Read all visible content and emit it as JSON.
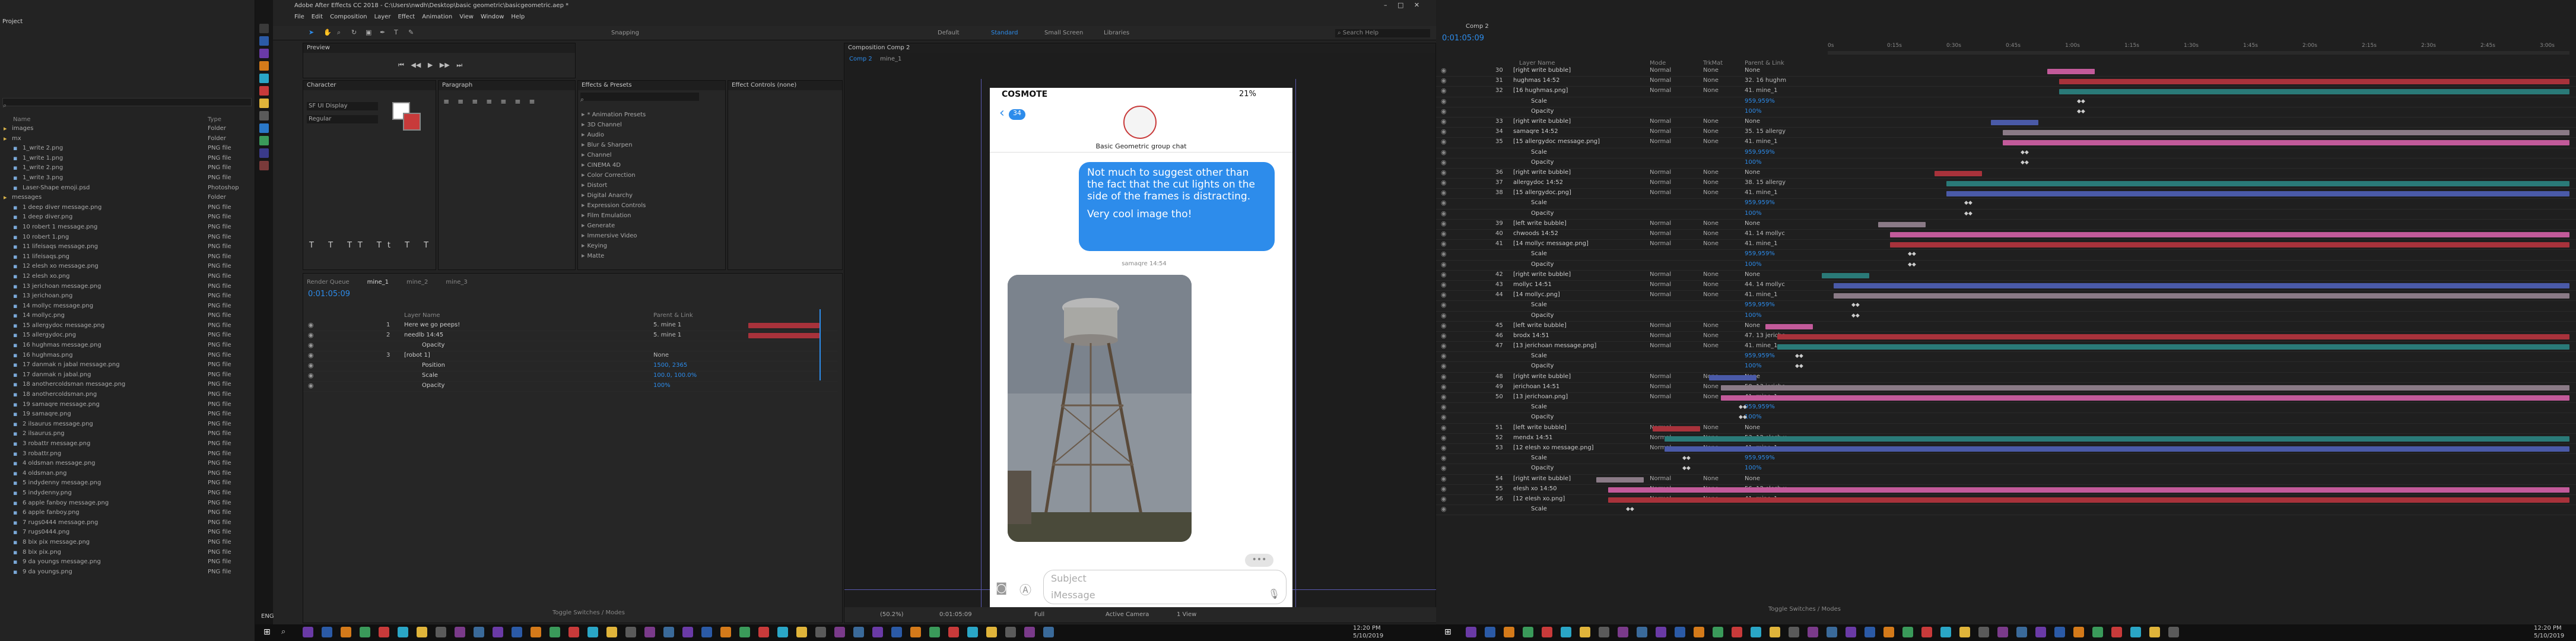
{
  "project": {
    "title": "Project",
    "cols": [
      "Name",
      "Type"
    ],
    "items": [
      {
        "name": "images",
        "type": "Folder"
      },
      {
        "name": "mx",
        "type": "Folder"
      },
      {
        "name": "1_write 2.png",
        "type": "PNG file"
      },
      {
        "name": "1_write 1.png",
        "type": "PNG file"
      },
      {
        "name": "1_write 2.png",
        "type": "PNG file"
      },
      {
        "name": "1_write 3.png",
        "type": "PNG file"
      },
      {
        "name": "Laser-Shape emoji.psd",
        "type": "Photoshop"
      },
      {
        "name": "messages",
        "type": "Folder"
      },
      {
        "name": "1 deep diver message.png",
        "type": "PNG file"
      },
      {
        "name": "1 deep diver.png",
        "type": "PNG file"
      },
      {
        "name": "10 robert 1 message.png",
        "type": "PNG file"
      },
      {
        "name": "10 robert 1.png",
        "type": "PNG file"
      },
      {
        "name": "11 lifeisaqs message.png",
        "type": "PNG file"
      },
      {
        "name": "11 lifeisaqs.png",
        "type": "PNG file"
      },
      {
        "name": "12 elesh xo message.png",
        "type": "PNG file"
      },
      {
        "name": "12 elesh xo.png",
        "type": "PNG file"
      },
      {
        "name": "13 jerichoan message.png",
        "type": "PNG file"
      },
      {
        "name": "13 jerichoan.png",
        "type": "PNG file"
      },
      {
        "name": "14 mollyc message.png",
        "type": "PNG file"
      },
      {
        "name": "14 mollyc.png",
        "type": "PNG file"
      },
      {
        "name": "15 allergydoc message.png",
        "type": "PNG file"
      },
      {
        "name": "15 allergydoc.png",
        "type": "PNG file"
      },
      {
        "name": "16 hughmas message.png",
        "type": "PNG file"
      },
      {
        "name": "16 hughmas.png",
        "type": "PNG file"
      },
      {
        "name": "17 danmak n jabal message.png",
        "type": "PNG file"
      },
      {
        "name": "17 danmak n jabal.png",
        "type": "PNG file"
      },
      {
        "name": "18 anothercoldsman message.png",
        "type": "PNG file"
      },
      {
        "name": "18 anothercoldsman.png",
        "type": "PNG file"
      },
      {
        "name": "19 samaqre message.png",
        "type": "PNG file"
      },
      {
        "name": "19 samaqre.png",
        "type": "PNG file"
      },
      {
        "name": "2 ilsaurus message.png",
        "type": "PNG file"
      },
      {
        "name": "2 ilsaurus.png",
        "type": "PNG file"
      },
      {
        "name": "3 robattr message.png",
        "type": "PNG file"
      },
      {
        "name": "3 robattr.png",
        "type": "PNG file"
      },
      {
        "name": "4 oldsman message.png",
        "type": "PNG file"
      },
      {
        "name": "4 oldsman.png",
        "type": "PNG file"
      },
      {
        "name": "5 indydenny message.png",
        "type": "PNG file"
      },
      {
        "name": "5 indydenny.png",
        "type": "PNG file"
      },
      {
        "name": "6 apple fanboy message.png",
        "type": "PNG file"
      },
      {
        "name": "6 apple fanboy.png",
        "type": "PNG file"
      },
      {
        "name": "7 rugs0444 message.png",
        "type": "PNG file"
      },
      {
        "name": "7 rugs0444.png",
        "type": "PNG file"
      },
      {
        "name": "8 bix pix message.png",
        "type": "PNG file"
      },
      {
        "name": "8 bix pix.png",
        "type": "PNG file"
      },
      {
        "name": "9 da youngs message.png",
        "type": "PNG file"
      },
      {
        "name": "9 da youngs.png",
        "type": "PNG file"
      }
    ]
  },
  "titlebar": {
    "title": "Adobe After Effects CC 2018 - C:\\Users\\nwdh\\Desktop\\basic geometric\\basicgeometric.aep *"
  },
  "menu": [
    "File",
    "Edit",
    "Composition",
    "Layer",
    "Effect",
    "Animation",
    "View",
    "Window",
    "Help"
  ],
  "workspaces": [
    "Default",
    "Standard",
    "Small Screen",
    "Libraries"
  ],
  "search_help": "Search Help",
  "snapping": "Snapping",
  "preview": {
    "title": "Preview"
  },
  "character": {
    "title": "Character",
    "font": "SF UI Display",
    "style": "Regular"
  },
  "paragraph": {
    "title": "Paragraph"
  },
  "effects": {
    "title": "Effects & Presets",
    "list": [
      "* Animation Presets",
      "3D Channel",
      "Audio",
      "Blur & Sharpen",
      "Channel",
      "CINEMA 4D",
      "Color Correction",
      "Distort",
      "Digital Anarchy",
      "Expression Controls",
      "Film Emulation",
      "Generate",
      "Immersive Video",
      "Keying",
      "Matte"
    ]
  },
  "effect_controls": {
    "title": "Effect Controls (none)"
  },
  "comp_panel": {
    "title": "Composition Comp 2",
    "tabs": [
      "Comp 2",
      "mine_1"
    ]
  },
  "phone": {
    "carrier": "COSMOTE",
    "battery": "21%",
    "back_count": "34",
    "group_name": "Basic Geometric group chat",
    "bubble_text": "Not much to suggest other than the fact that the cut lights on the side of the frames is distracting.",
    "bubble_text2": "Very cool image tho!",
    "sender": "samaqre 14:54",
    "subject_placeholder": "Subject",
    "imessage_placeholder": "iMessage"
  },
  "comp_footer": {
    "zoom": "(50.2%)",
    "timecode": "0:01:05:09",
    "quality": "Full",
    "camera": "Active Camera",
    "view": "1 View"
  },
  "left_timeline": {
    "tabs": [
      "Render Queue",
      "mine_1",
      "mine_2",
      "mine_3"
    ],
    "timecode": "0:01:05:09",
    "col_layer": "Layer Name",
    "col_parent": "Parent & Link",
    "layers": [
      {
        "num": "1",
        "name": "Here we go peeps!",
        "parent": "5. mine 1"
      },
      {
        "num": "2",
        "name": "needlb  14:45",
        "parent": "5. mine 1"
      },
      {
        "num": "",
        "name": "Opacity",
        "parent": ""
      },
      {
        "num": "3",
        "name": "[robot 1]",
        "parent": "None"
      },
      {
        "num": "",
        "name": "Position",
        "parent": "1500, 2365"
      },
      {
        "num": "",
        "name": "Scale",
        "parent": "100.0, 100.0%"
      },
      {
        "num": "",
        "name": "Opacity",
        "parent": "100%"
      }
    ],
    "toggle": "Toggle Switches / Modes"
  },
  "right_timeline": {
    "tab": "Comp 2",
    "timecode": "0:01:05:09",
    "col_layer": "Layer Name",
    "col_mode": "Mode",
    "col_trkmat": "TrkMat",
    "col_parent": "Parent & Link",
    "ticks": [
      "0s",
      "0:15s",
      "0:30s",
      "0:45s",
      "1:00s",
      "1:15s",
      "1:30s",
      "1:45s",
      "2:00s",
      "2:15s",
      "2:30s",
      "2:45s",
      "3:00s"
    ],
    "layers": [
      {
        "num": "30",
        "name": "[right write bubble]",
        "mode": "Normal",
        "trk": "None",
        "parent": "None"
      },
      {
        "num": "31",
        "name": "hughmas  14:52",
        "mode": "Normal",
        "trk": "None",
        "parent": "32. 16 hughm"
      },
      {
        "num": "32",
        "name": "[16 hughmas.png]",
        "mode": "Normal",
        "trk": "None",
        "parent": "41. mine_1"
      },
      {
        "num": "",
        "name": "Scale",
        "mode": "",
        "trk": "",
        "parent": "959,959%"
      },
      {
        "num": "",
        "name": "Opacity",
        "mode": "",
        "trk": "",
        "parent": "100%"
      },
      {
        "num": "33",
        "name": "[right write bubble]",
        "mode": "Normal",
        "trk": "None",
        "parent": "None"
      },
      {
        "num": "34",
        "name": "samaqre  14:52",
        "mode": "Normal",
        "trk": "None",
        "parent": "35. 15 allergy"
      },
      {
        "num": "35",
        "name": "[15 allergydoc message.png]",
        "mode": "Normal",
        "trk": "None",
        "parent": "41. mine_1"
      },
      {
        "num": "",
        "name": "Scale",
        "mode": "",
        "trk": "",
        "parent": "959,959%"
      },
      {
        "num": "",
        "name": "Opacity",
        "mode": "",
        "trk": "",
        "parent": "100%"
      },
      {
        "num": "36",
        "name": "[right write bubble]",
        "mode": "Normal",
        "trk": "None",
        "parent": "None"
      },
      {
        "num": "37",
        "name": "allergydoc  14:52",
        "mode": "Normal",
        "trk": "None",
        "parent": "38. 15 allergy"
      },
      {
        "num": "38",
        "name": "[15 allergydoc.png]",
        "mode": "Normal",
        "trk": "None",
        "parent": "41. mine_1"
      },
      {
        "num": "",
        "name": "Scale",
        "mode": "",
        "trk": "",
        "parent": "959,959%"
      },
      {
        "num": "",
        "name": "Opacity",
        "mode": "",
        "trk": "",
        "parent": "100%"
      },
      {
        "num": "39",
        "name": "[left write bubble]",
        "mode": "Normal",
        "trk": "None",
        "parent": "None"
      },
      {
        "num": "40",
        "name": "chwoods  14:52",
        "mode": "Normal",
        "trk": "None",
        "parent": "41. 14 mollyc"
      },
      {
        "num": "41",
        "name": "[14 mollyc message.png]",
        "mode": "Normal",
        "trk": "None",
        "parent": "41. mine_1"
      },
      {
        "num": "",
        "name": "Scale",
        "mode": "",
        "trk": "",
        "parent": "959,959%"
      },
      {
        "num": "",
        "name": "Opacity",
        "mode": "",
        "trk": "",
        "parent": "100%"
      },
      {
        "num": "42",
        "name": "[right write bubble]",
        "mode": "Normal",
        "trk": "None",
        "parent": "None"
      },
      {
        "num": "43",
        "name": "mollyc  14:51",
        "mode": "Normal",
        "trk": "None",
        "parent": "44. 14 mollyc"
      },
      {
        "num": "44",
        "name": "[14 mollyc.png]",
        "mode": "Normal",
        "trk": "None",
        "parent": "41. mine_1"
      },
      {
        "num": "",
        "name": "Scale",
        "mode": "",
        "trk": "",
        "parent": "959,959%"
      },
      {
        "num": "",
        "name": "Opacity",
        "mode": "",
        "trk": "",
        "parent": "100%"
      },
      {
        "num": "45",
        "name": "[left write bubble]",
        "mode": "Normal",
        "trk": "None",
        "parent": "None"
      },
      {
        "num": "46",
        "name": "brodx  14:51",
        "mode": "Normal",
        "trk": "None",
        "parent": "47. 13 jericho"
      },
      {
        "num": "47",
        "name": "[13 jerichoan message.png]",
        "mode": "Normal",
        "trk": "None",
        "parent": "41. mine_1"
      },
      {
        "num": "",
        "name": "Scale",
        "mode": "",
        "trk": "",
        "parent": "959,959%"
      },
      {
        "num": "",
        "name": "Opacity",
        "mode": "",
        "trk": "",
        "parent": "100%"
      },
      {
        "num": "48",
        "name": "[right write bubble]",
        "mode": "Normal",
        "trk": "None",
        "parent": "None"
      },
      {
        "num": "49",
        "name": "jerichoan  14:51",
        "mode": "Normal",
        "trk": "None",
        "parent": "50. 13 jericho"
      },
      {
        "num": "50",
        "name": "[13 jerichoan.png]",
        "mode": "Normal",
        "trk": "None",
        "parent": "41. mine_1"
      },
      {
        "num": "",
        "name": "Scale",
        "mode": "",
        "trk": "",
        "parent": "959,959%"
      },
      {
        "num": "",
        "name": "Opacity",
        "mode": "",
        "trk": "",
        "parent": "100%"
      },
      {
        "num": "51",
        "name": "[left write bubble]",
        "mode": "Normal",
        "trk": "None",
        "parent": "None"
      },
      {
        "num": "52",
        "name": "mendx  14:51",
        "mode": "Normal",
        "trk": "None",
        "parent": "53. 12 elesh x"
      },
      {
        "num": "53",
        "name": "[12 elesh xo message.png]",
        "mode": "Normal",
        "trk": "None",
        "parent": "41. mine_1"
      },
      {
        "num": "",
        "name": "Scale",
        "mode": "",
        "trk": "",
        "parent": "959,959%"
      },
      {
        "num": "",
        "name": "Opacity",
        "mode": "",
        "trk": "",
        "parent": "100%"
      },
      {
        "num": "54",
        "name": "[right write bubble]",
        "mode": "Normal",
        "trk": "None",
        "parent": "None"
      },
      {
        "num": "55",
        "name": "elesh xo  14:50",
        "mode": "Normal",
        "trk": "None",
        "parent": "56. 12 elesh x"
      },
      {
        "num": "56",
        "name": "[12 elesh xo.png]",
        "mode": "Normal",
        "trk": "None",
        "parent": "41. mine_1"
      },
      {
        "num": "",
        "name": "Scale",
        "mode": "",
        "trk": "",
        "parent": ""
      }
    ],
    "toggle": "Toggle Switches / Modes"
  },
  "taskbar": {
    "time_left": "12:20 PM",
    "date_left": "5/10/2019",
    "time_right": "12:20 PM",
    "date_right": "5/10/2019",
    "lang": "ENG"
  },
  "colors": {
    "accent": "#2d8ceb",
    "bubble": "#2d8ceb",
    "bar_pink": "#c25a9a",
    "bar_red": "#a8323b",
    "bar_teal": "#2a7a78",
    "bar_blue": "#4a5aa8",
    "bar_grey": "#8a7a86"
  }
}
